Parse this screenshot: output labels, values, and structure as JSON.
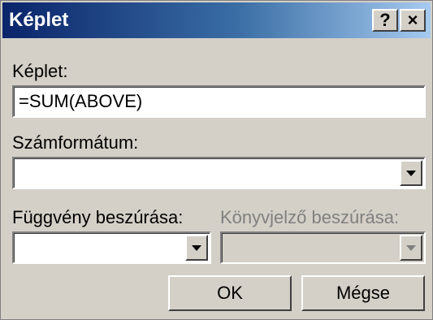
{
  "window": {
    "title": "Képlet",
    "help_label": "?",
    "close_label": "×"
  },
  "formula": {
    "label": "Képlet:",
    "value": "=SUM(ABOVE)"
  },
  "number_format": {
    "label": "Számformátum:",
    "value": ""
  },
  "paste_function": {
    "label": "Függvény beszúrása:",
    "value": ""
  },
  "paste_bookmark": {
    "label": "Könyvjelző beszúrása:",
    "value": "",
    "disabled": true
  },
  "buttons": {
    "ok_label": "OK",
    "cancel_label": "Mégse"
  },
  "icons": [
    "help-icon",
    "close-icon",
    "chevron-down-icon"
  ]
}
